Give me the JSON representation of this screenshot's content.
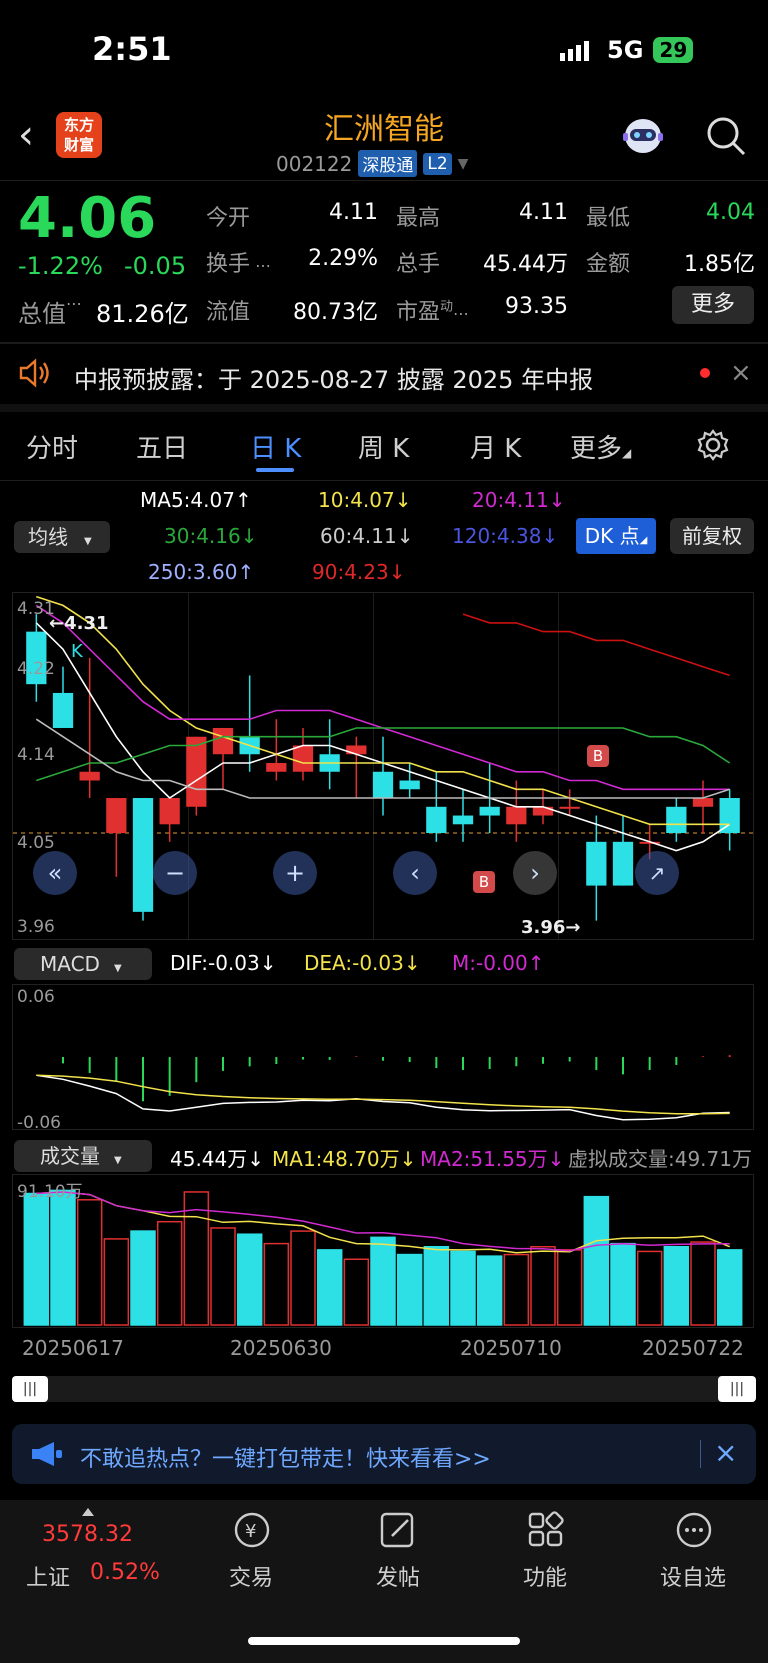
{
  "status": {
    "time": "2:51",
    "network": "5G",
    "battery": "29"
  },
  "header": {
    "title": "汇洲智能",
    "code": "002122",
    "badge1": "深股通",
    "badge2": "L2",
    "logo_line1": "东方",
    "logo_line2": "财富"
  },
  "quote": {
    "price": "4.06",
    "change_pct": "-1.22%",
    "change": "-0.05",
    "open_label": "今开",
    "open": "4.11",
    "high_label": "最高",
    "high": "4.11",
    "low_label": "最低",
    "low": "4.04",
    "turnover_label": "换手",
    "turnover": "2.29%",
    "volume_label": "总手",
    "volume": "45.44万",
    "amount_label": "金额",
    "amount": "1.85亿",
    "mktcap_label": "总值",
    "mktcap": "81.26亿",
    "float_label": "流值",
    "float": "80.73亿",
    "pe_label": "市盈",
    "pe_sup": "动",
    "pe": "93.35",
    "more_button": "更多"
  },
  "notice": {
    "text": "中报预披露：于 2025-08-27 披露 2025 年中报"
  },
  "tabs": [
    "分时",
    "五日",
    "日 K",
    "周 K",
    "月 K",
    "更多"
  ],
  "active_tab": "日 K",
  "ma_panel": {
    "selector": "均线",
    "ma5": "MA5:4.07",
    "ma10": "10:4.07",
    "ma20": "20:4.11",
    "ma30": "30:4.16",
    "ma60": "60:4.11",
    "ma120": "120:4.38",
    "ma250": "250:3.60",
    "ma90": "90:4.23",
    "dk_button": "DK 点",
    "fq_button": "前复权",
    "up": "↑",
    "down": "↓"
  },
  "kline": {
    "y_labels": [
      "4.31",
      "4.22",
      "4.14",
      "4.05",
      "3.96"
    ],
    "high_marker": "4.31",
    "low_marker": "3.96",
    "b_label": "B",
    "k_label": "K",
    "ylim": [
      3.96,
      4.31
    ]
  },
  "macd": {
    "selector": "MACD",
    "dif": "DIF:-0.03",
    "dea": "DEA:-0.03",
    "m": "M:-0.00",
    "top": "0.06",
    "bottom": "-0.06"
  },
  "vol": {
    "selector": "成交量",
    "value": "45.44万",
    "ma1": "MA1:48.70万",
    "ma2": "MA2:51.55万",
    "virtual": "虚拟成交量:49.71万",
    "top": "91.10万"
  },
  "dates": [
    "20250617",
    "20250630",
    "20250710",
    "20250722"
  ],
  "banner": {
    "text": "不敢追热点？一键打包带走！快来看看>>"
  },
  "bottom": {
    "index_value": "3578.32",
    "index_name": "上证",
    "index_change": "0.52%",
    "items": [
      "交易",
      "发帖",
      "功能",
      "设自选"
    ]
  },
  "chart_data": {
    "type": "candlestick",
    "ylim": [
      3.96,
      4.31
    ],
    "candles": [
      {
        "o": 4.29,
        "h": 4.31,
        "l": 4.21,
        "c": 4.23
      },
      {
        "o": 4.22,
        "h": 4.25,
        "l": 4.18,
        "c": 4.18
      },
      {
        "o": 4.12,
        "h": 4.26,
        "l": 4.1,
        "c": 4.13
      },
      {
        "o": 4.06,
        "h": 4.1,
        "l": 4.01,
        "c": 4.1
      },
      {
        "o": 4.1,
        "h": 4.1,
        "l": 3.96,
        "c": 3.97
      },
      {
        "o": 4.07,
        "h": 4.1,
        "l": 4.05,
        "c": 4.1
      },
      {
        "o": 4.09,
        "h": 4.17,
        "l": 4.08,
        "c": 4.17
      },
      {
        "o": 4.15,
        "h": 4.18,
        "l": 4.11,
        "c": 4.18
      },
      {
        "o": 4.17,
        "h": 4.24,
        "l": 4.13,
        "c": 4.15
      },
      {
        "o": 4.13,
        "h": 4.19,
        "l": 4.12,
        "c": 4.14
      },
      {
        "o": 4.13,
        "h": 4.18,
        "l": 4.12,
        "c": 4.16
      },
      {
        "o": 4.15,
        "h": 4.19,
        "l": 4.11,
        "c": 4.13
      },
      {
        "o": 4.15,
        "h": 4.17,
        "l": 4.1,
        "c": 4.16
      },
      {
        "o": 4.13,
        "h": 4.17,
        "l": 4.08,
        "c": 4.1
      },
      {
        "o": 4.12,
        "h": 4.14,
        "l": 4.1,
        "c": 4.11
      },
      {
        "o": 4.09,
        "h": 4.13,
        "l": 4.05,
        "c": 4.06
      },
      {
        "o": 4.08,
        "h": 4.11,
        "l": 4.05,
        "c": 4.07
      },
      {
        "o": 4.09,
        "h": 4.14,
        "l": 4.06,
        "c": 4.08
      },
      {
        "o": 4.07,
        "h": 4.12,
        "l": 4.05,
        "c": 4.09
      },
      {
        "o": 4.08,
        "h": 4.11,
        "l": 4.07,
        "c": 4.09
      },
      {
        "o": 4.09,
        "h": 4.11,
        "l": 4.08,
        "c": 4.09
      },
      {
        "o": 4.05,
        "h": 4.08,
        "l": 3.96,
        "c": 4.0
      },
      {
        "o": 4.05,
        "h": 4.08,
        "l": 4.0,
        "c": 4.0
      },
      {
        "o": 4.05,
        "h": 4.07,
        "l": 4.03,
        "c": 4.05
      },
      {
        "o": 4.09,
        "h": 4.1,
        "l": 4.05,
        "c": 4.06
      },
      {
        "o": 4.09,
        "h": 4.12,
        "l": 4.06,
        "c": 4.1
      },
      {
        "o": 4.1,
        "h": 4.11,
        "l": 4.04,
        "c": 4.06
      }
    ],
    "volumes": [
      84,
      86,
      80,
      55,
      60,
      66,
      85,
      62,
      58,
      52,
      60,
      48,
      42,
      56,
      45,
      50,
      47,
      44,
      45,
      50,
      48,
      82,
      52,
      47,
      50,
      53,
      48
    ],
    "ma_series": [
      {
        "name": "MA5",
        "color": "#ffffff",
        "values": [
          4.3,
          4.27,
          4.22,
          4.17,
          4.13,
          4.1,
          4.12,
          4.14,
          4.14,
          4.15,
          4.16,
          4.16,
          4.15,
          4.14,
          4.13,
          4.12,
          4.11,
          4.1,
          4.09,
          4.09,
          4.08,
          4.07,
          4.06,
          4.05,
          4.04,
          4.05,
          4.07
        ]
      },
      {
        "name": "MA10",
        "color": "#f2e24b",
        "values": [
          4.33,
          4.32,
          4.3,
          4.27,
          4.23,
          4.2,
          4.18,
          4.17,
          4.16,
          4.15,
          4.14,
          4.14,
          4.14,
          4.14,
          4.14,
          4.13,
          4.13,
          4.12,
          4.11,
          4.11,
          4.1,
          4.09,
          4.08,
          4.07,
          4.07,
          4.07,
          4.07
        ]
      },
      {
        "name": "MA20",
        "color": "#d12ad1",
        "values": [
          4.32,
          4.3,
          4.27,
          4.24,
          4.21,
          4.19,
          4.19,
          4.19,
          4.19,
          4.2,
          4.2,
          4.2,
          4.19,
          4.18,
          4.17,
          4.16,
          4.15,
          4.14,
          4.13,
          4.13,
          4.12,
          4.12,
          4.11,
          4.11,
          4.11,
          4.11,
          4.11
        ]
      },
      {
        "name": "MA30",
        "color": "#2aa83a",
        "values": [
          4.12,
          4.13,
          4.14,
          4.14,
          4.15,
          4.16,
          4.16,
          4.17,
          4.17,
          4.17,
          4.17,
          4.17,
          4.18,
          4.18,
          4.18,
          4.18,
          4.18,
          4.18,
          4.18,
          4.18,
          4.18,
          4.18,
          4.18,
          4.17,
          4.17,
          4.16,
          4.14
        ]
      },
      {
        "name": "MA60",
        "color": "#bbbbbb",
        "values": [
          4.19,
          4.17,
          4.15,
          4.13,
          4.12,
          4.12,
          4.11,
          4.11,
          4.1,
          4.1,
          4.1,
          4.1,
          4.1,
          4.1,
          4.1,
          4.1,
          4.1,
          4.1,
          4.1,
          4.1,
          4.1,
          4.1,
          4.1,
          4.1,
          4.1,
          4.1,
          4.11
        ]
      },
      {
        "name": "MA120",
        "color": "#cc1111",
        "values": [
          null,
          null,
          null,
          null,
          null,
          null,
          null,
          null,
          null,
          null,
          null,
          null,
          null,
          null,
          null,
          null,
          4.31,
          4.3,
          4.3,
          4.29,
          4.29,
          4.28,
          4.28,
          4.27,
          4.26,
          4.25,
          4.24
        ]
      }
    ]
  }
}
